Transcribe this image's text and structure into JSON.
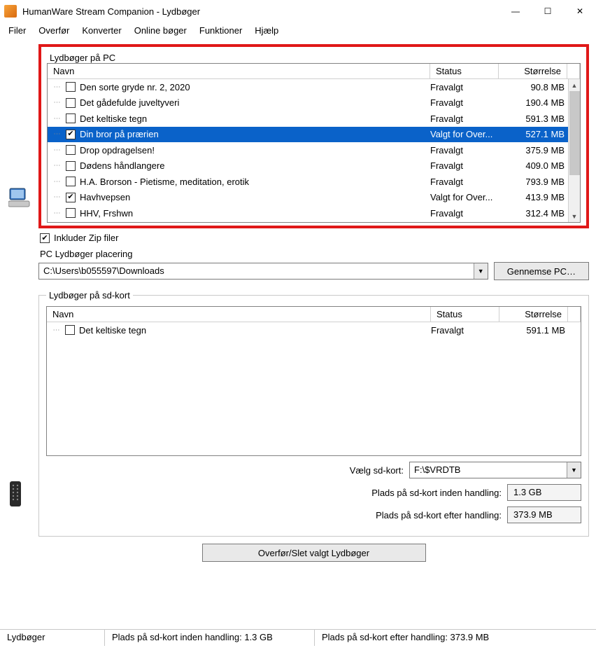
{
  "window": {
    "title": "HumanWare Stream Companion - Lydbøger"
  },
  "menu": {
    "file": "Filer",
    "transfer": "Overfør",
    "convert": "Konverter",
    "online": "Online bøger",
    "functions": "Funktioner",
    "help": "Hjælp"
  },
  "pc_group": {
    "legend": "Lydbøger på PC",
    "columns": {
      "name": "Navn",
      "status": "Status",
      "size": "Størrelse"
    },
    "rows": [
      {
        "checked": false,
        "selected": false,
        "name": "Den sorte gryde nr. 2, 2020",
        "status": "Fravalgt",
        "size": "90.8 MB"
      },
      {
        "checked": false,
        "selected": false,
        "name": "Det gådefulde juveltyveri",
        "status": "Fravalgt",
        "size": "190.4 MB"
      },
      {
        "checked": false,
        "selected": false,
        "name": "Det keltiske tegn",
        "status": "Fravalgt",
        "size": "591.3 MB"
      },
      {
        "checked": true,
        "selected": true,
        "name": "Din bror på prærien",
        "status": "Valgt for Over...",
        "size": "527.1 MB"
      },
      {
        "checked": false,
        "selected": false,
        "name": "Drop opdragelsen!",
        "status": "Fravalgt",
        "size": "375.9 MB"
      },
      {
        "checked": false,
        "selected": false,
        "name": "Dødens håndlangere",
        "status": "Fravalgt",
        "size": "409.0 MB"
      },
      {
        "checked": false,
        "selected": false,
        "name": "H.A. Brorson - Pietisme, meditation,  erotik",
        "status": "Fravalgt",
        "size": "793.9 MB"
      },
      {
        "checked": true,
        "selected": false,
        "name": "Havhvepsen",
        "status": "Valgt for Over...",
        "size": "413.9 MB"
      },
      {
        "checked": false,
        "selected": false,
        "name": "HHV, Frshwn",
        "status": "Fravalgt",
        "size": "312.4 MB"
      }
    ],
    "include_zip_label": "Inkluder Zip filer",
    "location_label": "PC Lydbøger placering",
    "location_value": "C:\\Users\\b055597\\Downloads",
    "browse_label": "Gennemse PC…"
  },
  "sd_group": {
    "legend": "Lydbøger på sd-kort",
    "columns": {
      "name": "Navn",
      "status": "Status",
      "size": "Størrelse"
    },
    "rows": [
      {
        "checked": false,
        "selected": false,
        "name": "Det keltiske tegn",
        "status": "Fravalgt",
        "size": "591.1 MB"
      }
    ],
    "select_sd_label": "Vælg sd-kort:",
    "select_sd_value": "F:\\$VRDTB",
    "space_before_label": "Plads på sd-kort inden handling:",
    "space_before_value": "1.3 GB",
    "space_after_label": "Plads på sd-kort efter handling:",
    "space_after_value": "373.9 MB"
  },
  "action_button": "Overfør/Slet valgt Lydbøger",
  "statusbar": {
    "tab": "Lydbøger",
    "before": "Plads på sd-kort inden handling: 1.3 GB",
    "after": "Plads på sd-kort efter handling: 373.9 MB"
  }
}
